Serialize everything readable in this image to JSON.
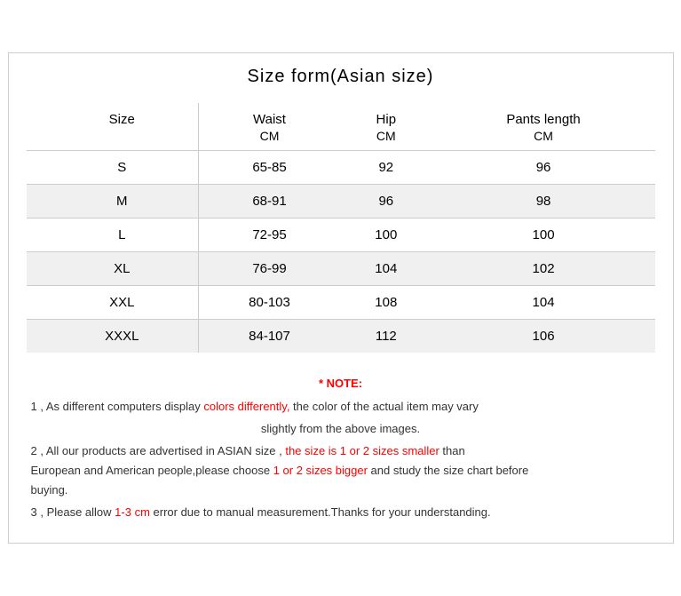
{
  "title": "Size form(Asian size)",
  "table": {
    "headers": [
      "Size",
      "Waist",
      "Hip",
      "Pants length"
    ],
    "units": [
      "",
      "CM",
      "CM",
      "CM"
    ],
    "rows": [
      {
        "size": "S",
        "waist": "65-85",
        "hip": "92",
        "pants": "96"
      },
      {
        "size": "M",
        "waist": "68-91",
        "hip": "96",
        "pants": "98"
      },
      {
        "size": "L",
        "waist": "72-95",
        "hip": "100",
        "pants": "100"
      },
      {
        "size": "XL",
        "waist": "76-99",
        "hip": "104",
        "pants": "102"
      },
      {
        "size": "XXL",
        "waist": "80-103",
        "hip": "108",
        "pants": "104"
      },
      {
        "size": "XXXL",
        "waist": "84-107",
        "hip": "112",
        "pants": "106"
      }
    ]
  },
  "note": {
    "title": "* NOTE:",
    "line1_pre": "1 , As different computers display ",
    "line1_red": "colors differently,",
    "line1_post": " the color of the actual item may vary",
    "line1_cont": "slightly from the above images.",
    "line2_pre": "2 , All our products are advertised in ASIAN size , ",
    "line2_red1": "the size is 1 or 2 sizes smaller",
    "line2_mid": " than\nEuropean and American people,please choose ",
    "line2_red2": "1 or 2 sizes bigger",
    "line2_post": " and study the size chart before\nbuying.",
    "line3_pre": "3 , Please allow ",
    "line3_red": "1-3 cm",
    "line3_post": " error due to manual measurement.Thanks for your understanding."
  }
}
